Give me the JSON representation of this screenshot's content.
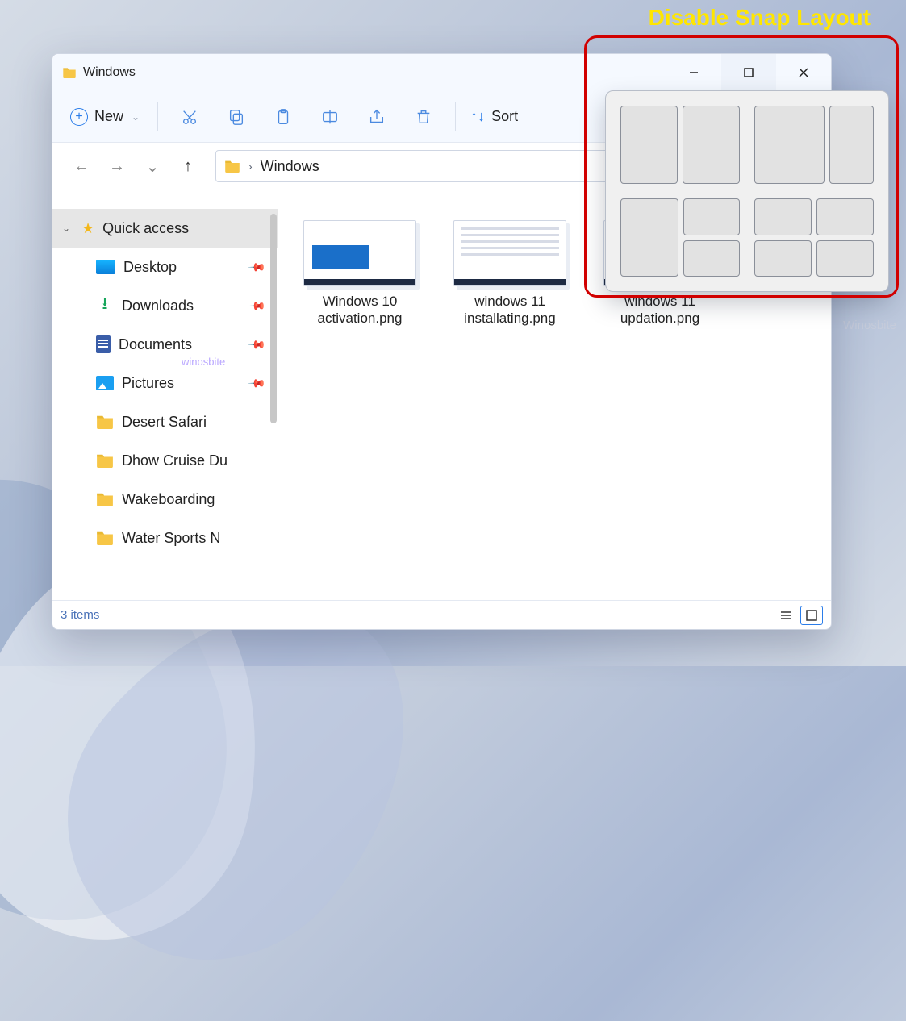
{
  "annotation": {
    "label": "Disable Snap Layout"
  },
  "watermarks": {
    "right": "Winosbite",
    "inline": "winosbite"
  },
  "window": {
    "title": "Windows",
    "toolbar": {
      "new_label": "New",
      "sort_label": "Sort"
    },
    "breadcrumb": {
      "location": "Windows"
    },
    "sidebar": {
      "quick_access": "Quick access",
      "items": [
        {
          "label": "Desktop",
          "pinned": true,
          "icon": "desktop"
        },
        {
          "label": "Downloads",
          "pinned": true,
          "icon": "downloads"
        },
        {
          "label": "Documents",
          "pinned": true,
          "icon": "documents"
        },
        {
          "label": "Pictures",
          "pinned": true,
          "icon": "pictures"
        },
        {
          "label": "Desert Safari",
          "pinned": false,
          "icon": "folder"
        },
        {
          "label": "Dhow Cruise Du",
          "pinned": false,
          "icon": "folder"
        },
        {
          "label": "Wakeboarding",
          "pinned": false,
          "icon": "folder"
        },
        {
          "label": "Water Sports N",
          "pinned": false,
          "icon": "folder"
        }
      ]
    },
    "files": [
      {
        "name": "Windows 10 activation.png"
      },
      {
        "name": "windows 11 installating.png"
      },
      {
        "name": "windows 11 updation.png"
      }
    ],
    "status": {
      "count_text": "3 items"
    }
  }
}
